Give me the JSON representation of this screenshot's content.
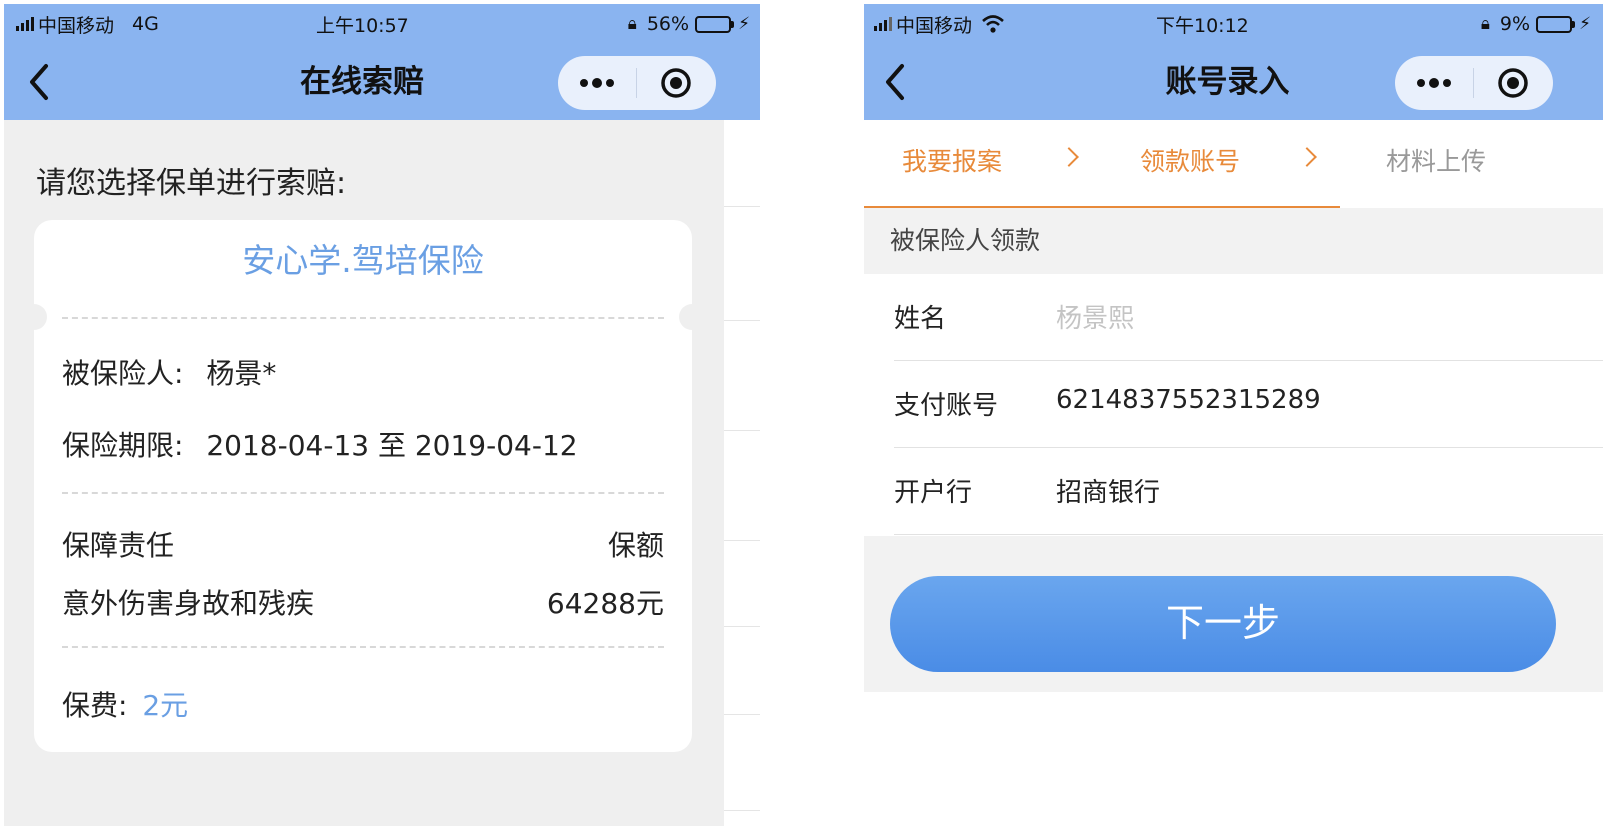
{
  "left": {
    "status": {
      "carrier": "中国移动",
      "network": "4G",
      "time": "上午10:57",
      "battery": "56%",
      "battery_level": 0.56
    },
    "nav": {
      "title": "在线索赔"
    },
    "prompt": "请您选择保单进行索赔:",
    "card": {
      "title": "安心学.驾培保险",
      "insured_label": "被保险人:",
      "insured_value": "杨景*",
      "period_label": "保险期限:",
      "period_value": "2018-04-13 至 2019-04-12",
      "coverage_header": "保障责任",
      "amount_header": "保额",
      "coverage_item": "意外伤害身故和残疾",
      "coverage_amount": "64288元",
      "fee_label": "保费:",
      "fee_value": "2元"
    }
  },
  "right": {
    "status": {
      "carrier": "中国移动",
      "time": "下午10:12",
      "battery": "9%",
      "battery_level": 0.09
    },
    "nav": {
      "title": "账号录入"
    },
    "steps": [
      {
        "label": "我要报案",
        "state": "done"
      },
      {
        "label": "领款账号",
        "state": "current"
      },
      {
        "label": "材料上传",
        "state": "pending"
      }
    ],
    "section_title": "被保险人领款",
    "form": {
      "name_label": "姓名",
      "name_placeholder": "杨景熙",
      "account_label": "支付账号",
      "account_value": "6214837552315289",
      "bank_label": "开户行",
      "bank_value": "招商银行"
    },
    "next_button": "下一步"
  },
  "colors": {
    "nav_bg": "#8ab4f0",
    "accent_blue": "#6a9fe3",
    "step_orange": "#e88a3a",
    "battery_low": "#e53935"
  },
  "icons": [
    "signal-icon",
    "wifi-icon",
    "orientation-lock-icon",
    "battery-icon",
    "charging-icon",
    "back-chevron-icon",
    "more-dots-icon",
    "target-icon"
  ]
}
